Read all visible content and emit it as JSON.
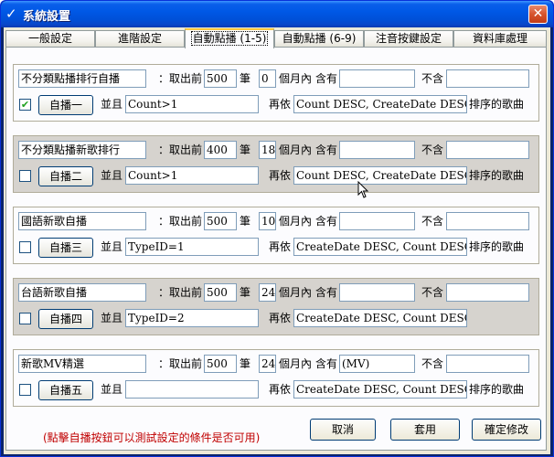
{
  "window": {
    "title": "系統設置",
    "close_glyph": "✕",
    "app_glyph": "✓"
  },
  "tabs": [
    {
      "label": "一般設定",
      "active": false
    },
    {
      "label": "進階設定",
      "active": false
    },
    {
      "label": "自動點播 (1-5)",
      "active": true
    },
    {
      "label": "自動點播 (6-9)",
      "active": false
    },
    {
      "label": "注音按鍵設定",
      "active": false
    },
    {
      "label": "資料庫處理",
      "active": false
    }
  ],
  "labels": {
    "take_first": "：取出前",
    "unit_items": "筆",
    "within_months": "個月內",
    "contains": "含有",
    "excludes": "不含",
    "and": "並且",
    "then_by": "再依",
    "sorted_songs": "排序的歌曲"
  },
  "groups": [
    {
      "name": "不分類點播排行自播",
      "count": "500",
      "months": "0",
      "contains": "",
      "excludes": "",
      "checked": true,
      "button": "自播一",
      "condition": "Count>1",
      "order": "Count DESC, CreateDate DESC",
      "show_suffix": true
    },
    {
      "name": "不分類點播新歌排行",
      "count": "400",
      "months": "18",
      "contains": "",
      "excludes": "",
      "checked": false,
      "button": "自播二",
      "condition": "Count>1",
      "order": "Count DESC, CreateDate DESC",
      "show_suffix": true
    },
    {
      "name": "國語新歌自播",
      "count": "500",
      "months": "10",
      "contains": "",
      "excludes": "",
      "checked": false,
      "button": "自播三",
      "condition": "TypeID=1",
      "order": "CreateDate DESC, Count DESC",
      "show_suffix": true
    },
    {
      "name": "台語新歌自播",
      "count": "500",
      "months": "24",
      "contains": "",
      "excludes": "",
      "checked": false,
      "button": "自播四",
      "condition": "TypeID=2",
      "order": "CreateDate DESC, Count DESC",
      "show_suffix": false
    },
    {
      "name": "新歌MV精選",
      "count": "500",
      "months": "24",
      "contains": "(MV)",
      "excludes": "",
      "checked": false,
      "button": "自播五",
      "condition": "",
      "order": "CreateDate DESC, Count DESC",
      "show_suffix": true
    }
  ],
  "note": "(點擊自播按鈕可以測試設定的條件是否可用)",
  "footer": {
    "cancel": "取消",
    "apply": "套用",
    "ok": "確定修改"
  },
  "colors": {
    "title_bar": "#0058e6",
    "group_gray": "#d6d3ce",
    "note_red": "#c00000",
    "active_tab_accent": "#ffc83c"
  }
}
